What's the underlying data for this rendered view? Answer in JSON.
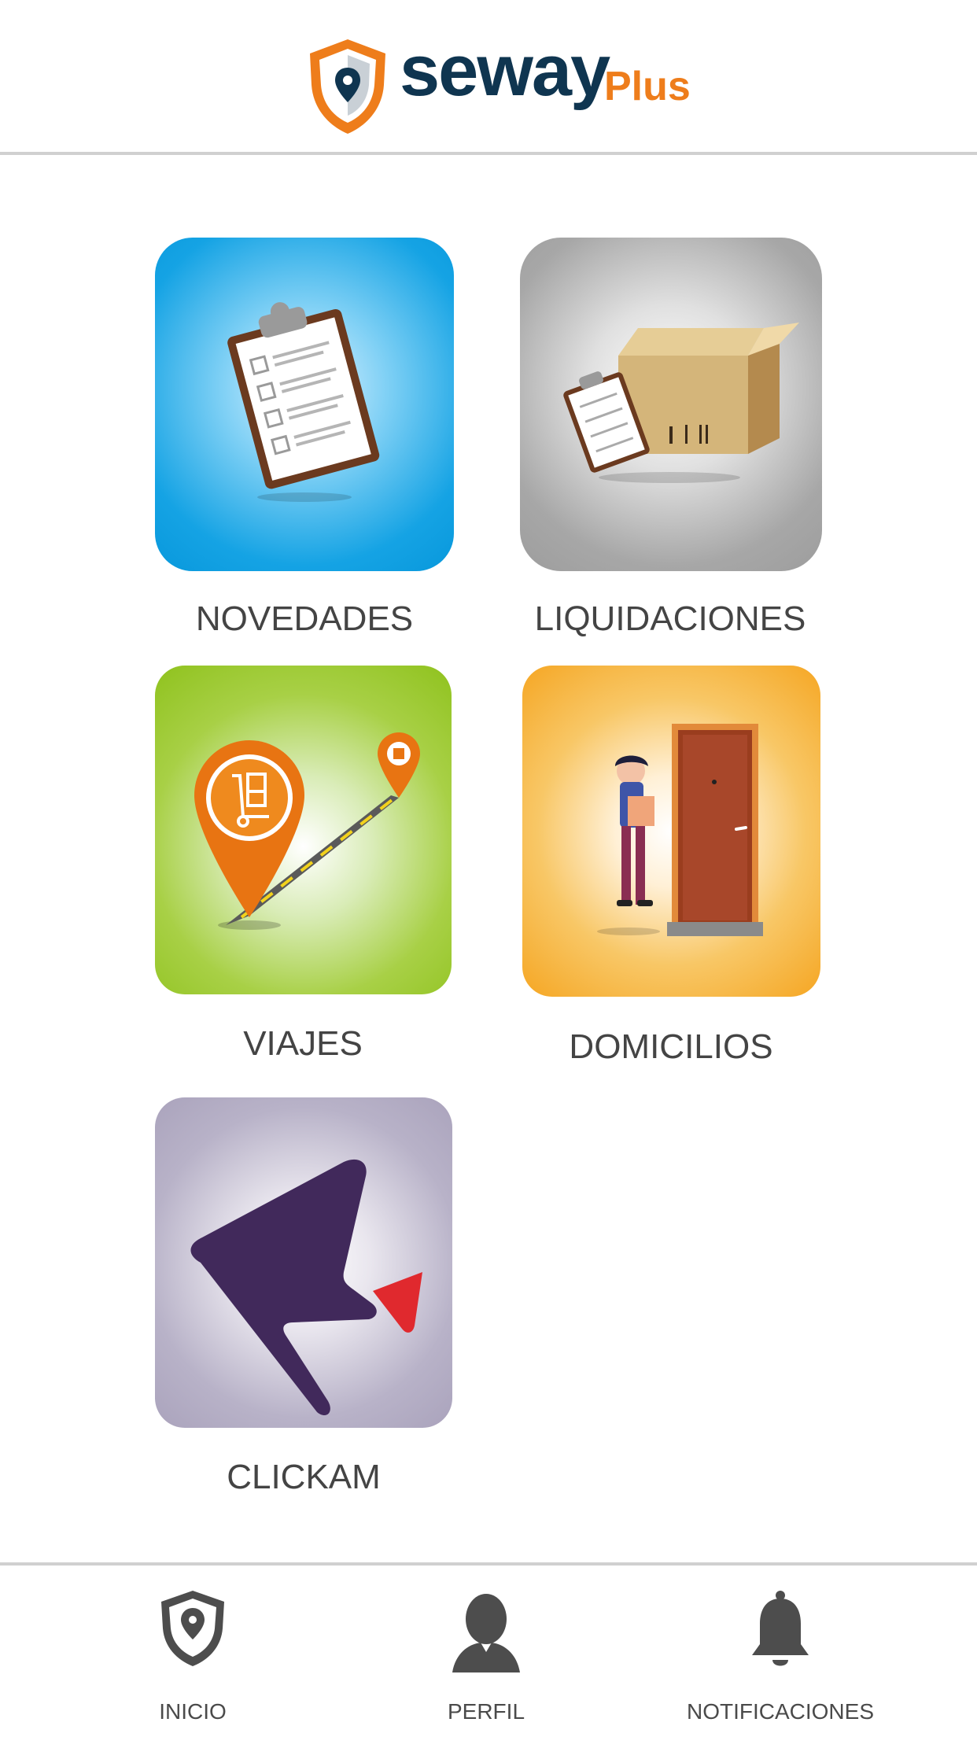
{
  "app": {
    "brand": "seway",
    "brand_suffix": "Plus",
    "brand_color": "#0f3550",
    "accent_color": "#ee7d1b"
  },
  "menu": {
    "tiles": [
      {
        "label": "NOVEDADES",
        "icon": "clipboard-icon",
        "color": "#0898dc"
      },
      {
        "label": "LIQUIDACIONES",
        "icon": "package-box-icon",
        "color": "#9d9d9d"
      },
      {
        "label": "VIAJES",
        "icon": "route-pin-icon",
        "color": "#8fc21d"
      },
      {
        "label": "DOMICILIOS",
        "icon": "delivery-person-icon",
        "color": "#f5a623"
      },
      {
        "label": "CLICKAM",
        "icon": "clickam-logo-icon",
        "color": "#aaa3bc"
      }
    ]
  },
  "bottom_nav": {
    "items": [
      {
        "label": "INICIO",
        "icon": "shield-location-icon"
      },
      {
        "label": "PERFIL",
        "icon": "user-icon"
      },
      {
        "label": "NOTIFICACIONES",
        "icon": "bell-icon"
      }
    ]
  }
}
